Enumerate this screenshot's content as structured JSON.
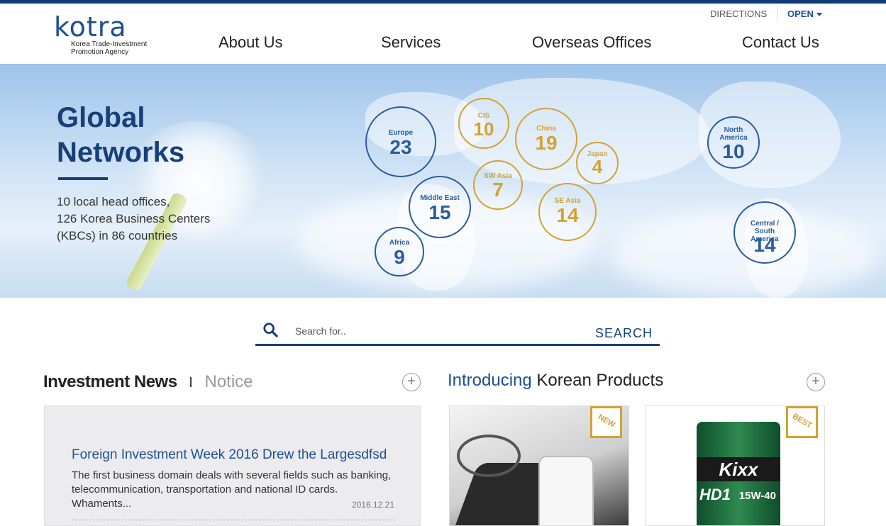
{
  "header": {
    "logo_word": "kotra",
    "logo_sub1": "Korea Trade-Investment",
    "logo_sub2": "Promotion Agency",
    "util": {
      "directions": "DIRECTIONS",
      "open": "OPEN"
    },
    "nav": [
      "About Us",
      "Services",
      "Overseas Offices",
      "Contact Us"
    ]
  },
  "hero": {
    "title_line1": "Global",
    "title_line2": "Networks",
    "desc_line1": "10 local head offices,",
    "desc_line2": "126 Korea Business Centers",
    "desc_line3": "(KBCs) in 86 countries",
    "regions": [
      {
        "name": "Europe",
        "count": "23",
        "color": "blue"
      },
      {
        "name": "CIS",
        "count": "10",
        "color": "gold"
      },
      {
        "name": "China",
        "count": "19",
        "color": "gold"
      },
      {
        "name": "Japan",
        "count": "4",
        "color": "gold"
      },
      {
        "name": "SW Asia",
        "count": "7",
        "color": "gold"
      },
      {
        "name": "Middle East",
        "count": "15",
        "color": "blue"
      },
      {
        "name": "SE Asia",
        "count": "14",
        "color": "gold"
      },
      {
        "name": "Africa",
        "count": "9",
        "color": "blue"
      },
      {
        "name": "North America",
        "count": "10",
        "color": "blue"
      },
      {
        "name": "Central / South America",
        "count": "14",
        "color": "blue"
      }
    ]
  },
  "search": {
    "placeholder": "Search for..",
    "button": "SEARCH"
  },
  "news_section": {
    "tab_active": "Investment News",
    "tab_separator": "I",
    "tab_inactive": "Notice",
    "plus": "+",
    "item": {
      "headline": "Foreign Investment Week 2016 Drew the Largesdfsd",
      "body": "The first business domain deals with several fields such as banking, telecommunication, transportation and national ID cards. Whaments...",
      "date": "2016.12.21"
    }
  },
  "products_section": {
    "title_accent": "Introducing",
    "title_rest": "Korean Products",
    "plus": "+",
    "badges": [
      "NEW",
      "BEST"
    ],
    "kixx_brand": "Kixx",
    "kixx_model": "HD1",
    "kixx_grade": "15W-40"
  },
  "colors": {
    "brand_blue": "#173f7a",
    "accent_gold": "#d3a234",
    "top_bar": "#0f3b7a"
  }
}
